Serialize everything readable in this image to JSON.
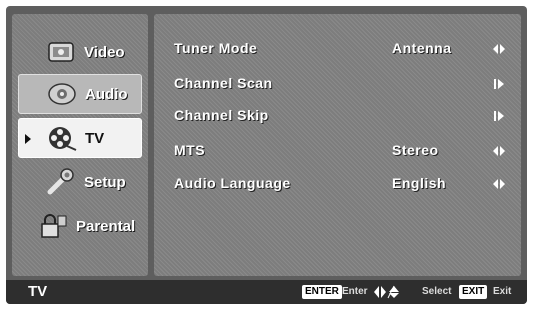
{
  "menu": {
    "items": [
      {
        "label": "Video",
        "icon": "video-icon"
      },
      {
        "label": "Audio",
        "icon": "audio-icon"
      },
      {
        "label": "TV",
        "icon": "tv-film-reel-icon"
      },
      {
        "label": "Setup",
        "icon": "setup-wrench-icon"
      },
      {
        "label": "Parental",
        "icon": "parental-lock-icon"
      }
    ],
    "active_index": 2
  },
  "settings": {
    "rows": [
      {
        "label": "Tuner Mode",
        "value": "Antenna",
        "control": "left-right-arrows"
      },
      {
        "label": "Channel Scan",
        "value": "",
        "control": "enter-arrow"
      },
      {
        "label": "Channel Skip",
        "value": "",
        "control": "enter-arrow"
      },
      {
        "label": "MTS",
        "value": "Stereo",
        "control": "left-right-arrows"
      },
      {
        "label": "Audio Language",
        "value": "English",
        "control": "left-right-arrows"
      }
    ]
  },
  "footer": {
    "title": "TV",
    "enter_key": "ENTER",
    "enter_hint": "Enter",
    "select_hint": "Select",
    "exit_key": "EXIT",
    "exit_hint": "Exit"
  }
}
